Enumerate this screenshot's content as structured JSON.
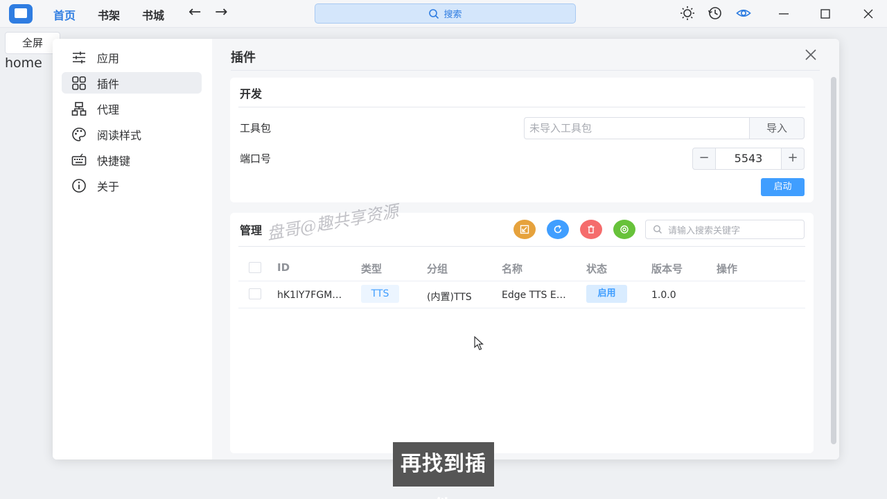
{
  "titlebar": {
    "nav": [
      "首页",
      "书架",
      "书城"
    ],
    "search_placeholder": "搜索"
  },
  "background": {
    "fullscreen_label": "全屏",
    "home_text": "home"
  },
  "sidebar": {
    "items": [
      {
        "label": "应用",
        "icon": "sliders-icon"
      },
      {
        "label": "插件",
        "icon": "grid-icon"
      },
      {
        "label": "代理",
        "icon": "network-icon"
      },
      {
        "label": "阅读样式",
        "icon": "palette-icon"
      },
      {
        "label": "快捷键",
        "icon": "keyboard-icon"
      },
      {
        "label": "关于",
        "icon": "info-icon"
      }
    ],
    "active_index": 1
  },
  "dialog": {
    "title": "插件"
  },
  "dev": {
    "title": "开发",
    "toolkit_label": "工具包",
    "toolkit_placeholder": "未导入工具包",
    "import_label": "导入",
    "port_label": "端口号",
    "minus": "−",
    "port_value": "5543",
    "plus": "+",
    "start_label": "启动"
  },
  "manage": {
    "title": "管理",
    "search_placeholder": "请输入搜索关键字",
    "action_colors": [
      "#e6a23c",
      "#409eff",
      "#f56c6c",
      "#67c23a"
    ],
    "columns": [
      "ID",
      "类型",
      "分组",
      "名称",
      "状态",
      "版本号",
      "操作"
    ],
    "rows": [
      {
        "id": "hK1lY7FGM…",
        "type": "TTS",
        "group": "(内置)TTS",
        "name": "Edge TTS E…",
        "status": "启用",
        "version": "1.0.0",
        "action": ""
      }
    ]
  },
  "overlay": {
    "watermark": "盘哥@趣共享资源",
    "subtitle": "再找到插件"
  }
}
